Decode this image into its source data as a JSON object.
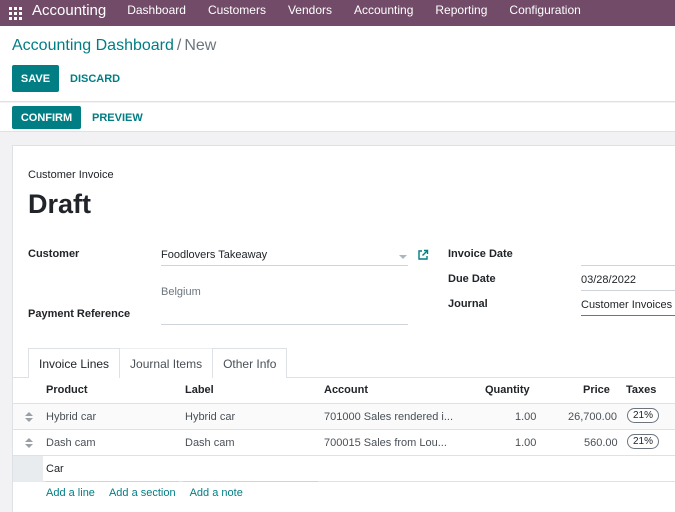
{
  "navbar": {
    "brand": "Accounting",
    "menu": [
      "Dashboard",
      "Customers",
      "Vendors",
      "Accounting",
      "Reporting",
      "Configuration"
    ]
  },
  "breadcrumb": {
    "parent": "Accounting Dashboard",
    "separator": "/",
    "current": "New"
  },
  "actions": {
    "save": "SAVE",
    "discard": "DISCARD",
    "confirm": "CONFIRM",
    "preview": "PREVIEW"
  },
  "invoice": {
    "type_label": "Customer Invoice",
    "status": "Draft",
    "customer_label": "Customer",
    "customer_value": "Foodlovers Takeaway",
    "customer_address": "Belgium",
    "payment_reference_label": "Payment Reference",
    "payment_reference_value": "",
    "invoice_date_label": "Invoice Date",
    "invoice_date_value": "",
    "due_date_label": "Due Date",
    "due_date_value": "03/28/2022",
    "journal_label": "Journal",
    "journal_value": "Customer Invoices"
  },
  "tabs": [
    "Invoice Lines",
    "Journal Items",
    "Other Info"
  ],
  "table": {
    "columns": [
      "Product",
      "Label",
      "Account",
      "Quantity",
      "Price",
      "Taxes"
    ],
    "rows": [
      {
        "product": "Hybrid car",
        "label": "Hybrid car",
        "account": "701000 Sales rendered i...",
        "quantity": "1.00",
        "price": "26,700.00",
        "tax": "21%"
      },
      {
        "product": "Dash cam",
        "label": "Dash cam",
        "account": "700015 Sales from Lou...",
        "quantity": "1.00",
        "price": "560.00",
        "tax": "21%"
      }
    ],
    "editing_product": "Car"
  },
  "add_links": [
    "Add a line",
    "Add a section",
    "Add a note"
  ],
  "colors": {
    "navbar": "#714B67",
    "primary": "#017e84"
  }
}
